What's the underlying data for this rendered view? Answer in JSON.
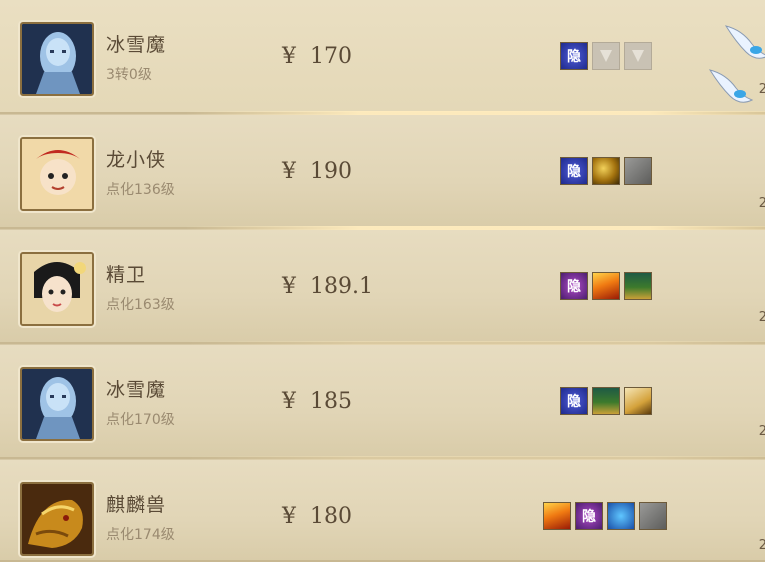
{
  "items": [
    {
      "name": "冰雪魔",
      "level": "3转0级",
      "currency": "¥",
      "price": "170",
      "avatar": "ice-demon-avatar",
      "skills": [
        {
          "icon": "hidden-skill-icon",
          "label": "隐",
          "style": "hidden-blue"
        },
        {
          "icon": "inactive-skill-icon",
          "label": "",
          "style": "grey"
        },
        {
          "icon": "inactive-skill-icon",
          "label": "",
          "style": "grey"
        }
      ],
      "right_digit": "2"
    },
    {
      "name": "龙小侠",
      "level": "点化136级",
      "currency": "¥",
      "price": "190",
      "avatar": "dragon-kid-avatar",
      "skills": [
        {
          "icon": "hidden-skill-icon",
          "label": "隐",
          "style": "hidden-blue"
        },
        {
          "icon": "gold-skill-icon",
          "label": "",
          "style": "gold"
        },
        {
          "icon": "stone-skill-icon",
          "label": "",
          "style": "stone"
        }
      ],
      "right_digit": "2"
    },
    {
      "name": "精卫",
      "level": "点化163级",
      "currency": "¥",
      "price": "189.1",
      "avatar": "jingwei-avatar",
      "skills": [
        {
          "icon": "hidden-skill-icon",
          "label": "隐",
          "style": "hidden-purple"
        },
        {
          "icon": "fire-skill-icon",
          "label": "",
          "style": "fire"
        },
        {
          "icon": "forest-skill-icon",
          "label": "",
          "style": "forest"
        }
      ],
      "right_digit": "2"
    },
    {
      "name": "冰雪魔",
      "level": "点化170级",
      "currency": "¥",
      "price": "185",
      "avatar": "ice-demon-avatar",
      "skills": [
        {
          "icon": "hidden-skill-icon",
          "label": "隐",
          "style": "hidden-blue"
        },
        {
          "icon": "forest-skill-icon",
          "label": "",
          "style": "forest"
        },
        {
          "icon": "lightning-skill-icon",
          "label": "",
          "style": "lightning"
        }
      ],
      "right_digit": "2"
    },
    {
      "name": "麒麟兽",
      "level": "点化174级",
      "currency": "¥",
      "price": "180",
      "avatar": "qilin-avatar",
      "skills": [
        {
          "icon": "fire-skill-icon",
          "label": "",
          "style": "fire"
        },
        {
          "icon": "hidden-skill-icon",
          "label": "隐",
          "style": "hidden-purple"
        },
        {
          "icon": "ice-skill-icon",
          "label": "",
          "style": "ice"
        },
        {
          "icon": "stone-skill-icon",
          "label": "",
          "style": "stone"
        }
      ],
      "right_digit": "2"
    }
  ]
}
